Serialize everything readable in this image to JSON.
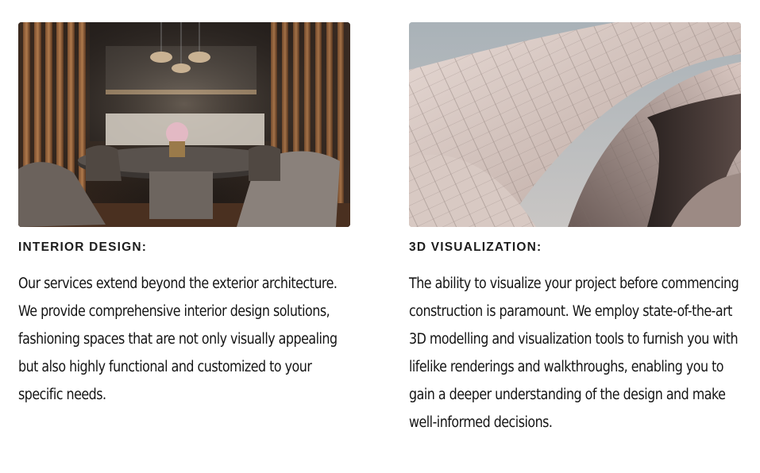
{
  "sections": [
    {
      "title": "INTERIOR DESIGN:",
      "image": "interior-dining-room-photo",
      "description": "Our services extend beyond the exterior architecture. We provide comprehensive interior design solutions, fashioning spaces that are not only visually appealing but also highly functional and customized to your specific needs."
    },
    {
      "title": "3D VISUALIZATION:",
      "image": "3d-architectural-curves-render",
      "description": "The ability to visualize your project before commencing construction is paramount. We employ state-of-the-art 3D modelling and visualization tools to furnish you with lifelike renderings and walkthroughs, enabling you to gain a deeper understanding of the design and make well-informed decisions."
    }
  ]
}
